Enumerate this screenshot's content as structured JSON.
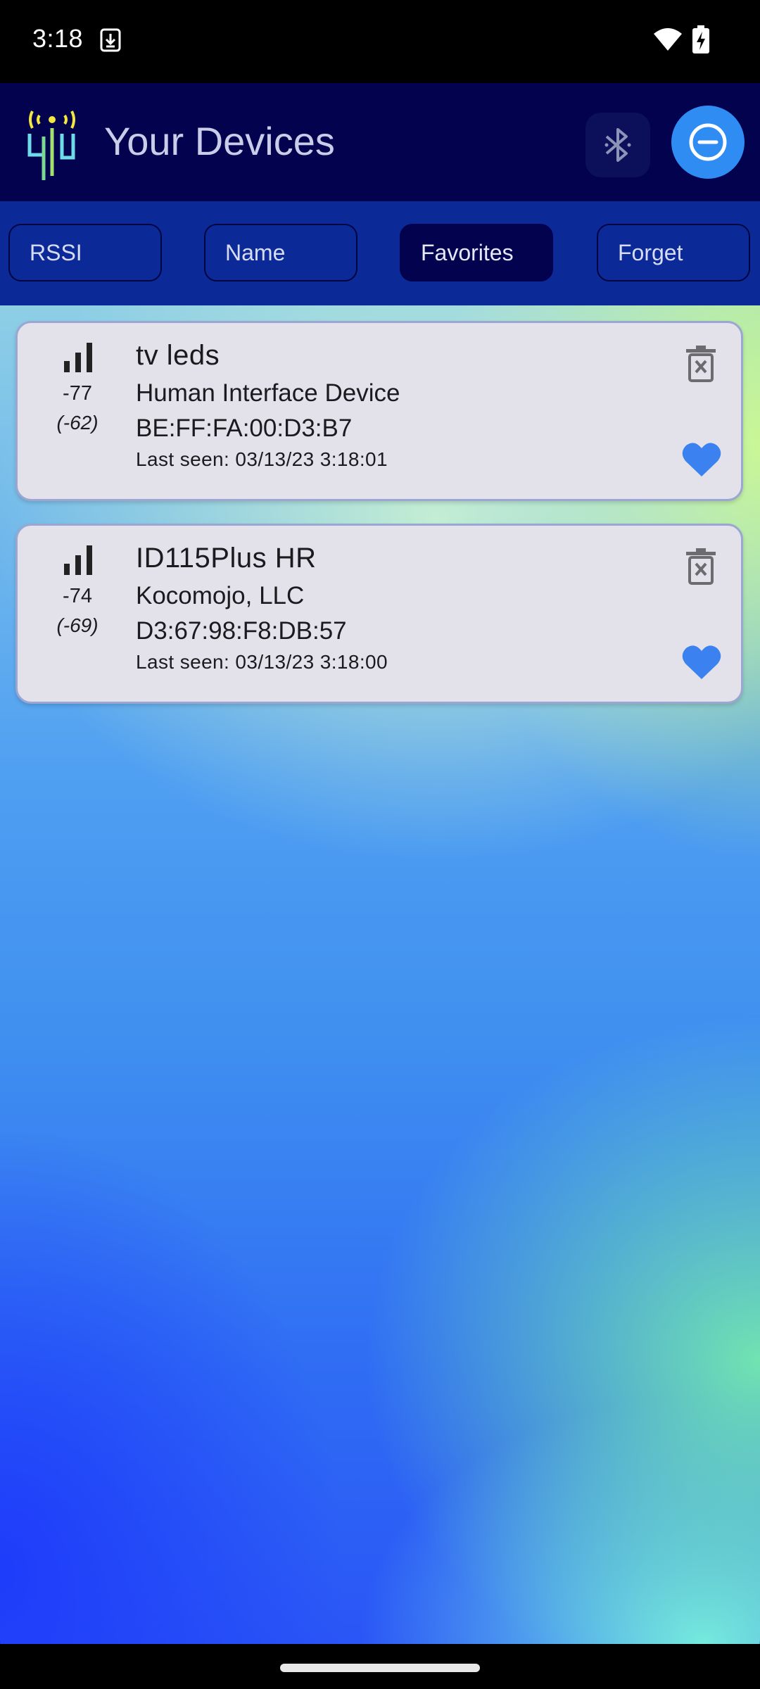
{
  "status_bar": {
    "time": "3:18",
    "icons": [
      "download-icon",
      "wifi-icon",
      "battery-charging-icon"
    ]
  },
  "app_bar": {
    "title": "Your Devices",
    "logo_icon": "antenna-logo-icon",
    "actions": [
      "bluetooth-icon",
      "minus-circle-icon"
    ]
  },
  "sort_bar": {
    "buttons": [
      {
        "label": "RSSI",
        "active": false
      },
      {
        "label": "Name",
        "active": false
      },
      {
        "label": "Favorites",
        "active": true
      },
      {
        "label": "Forget",
        "active": false
      }
    ]
  },
  "devices": [
    {
      "name": "tv leds",
      "manufacturer": "Human Interface Device",
      "mac": "BE:FF:FA:00:D3:B7",
      "last_seen": "Last seen: 03/13/23 3:18:01",
      "rssi": "-77",
      "rssi_avg": "(-62)",
      "favorite": true
    },
    {
      "name": "ID115Plus HR",
      "manufacturer": "Kocomojo, LLC",
      "mac": "D3:67:98:F8:DB:57",
      "last_seen": "Last seen: 03/13/23 3:18:00",
      "rssi": "-74",
      "rssi_avg": "(-69)",
      "favorite": true
    }
  ],
  "colors": {
    "app_bar": "#02024f",
    "sort_bar": "#0b2a98",
    "accent": "#2f8cf2",
    "heart": "#3b82f0",
    "card": "#e3e2ea"
  }
}
